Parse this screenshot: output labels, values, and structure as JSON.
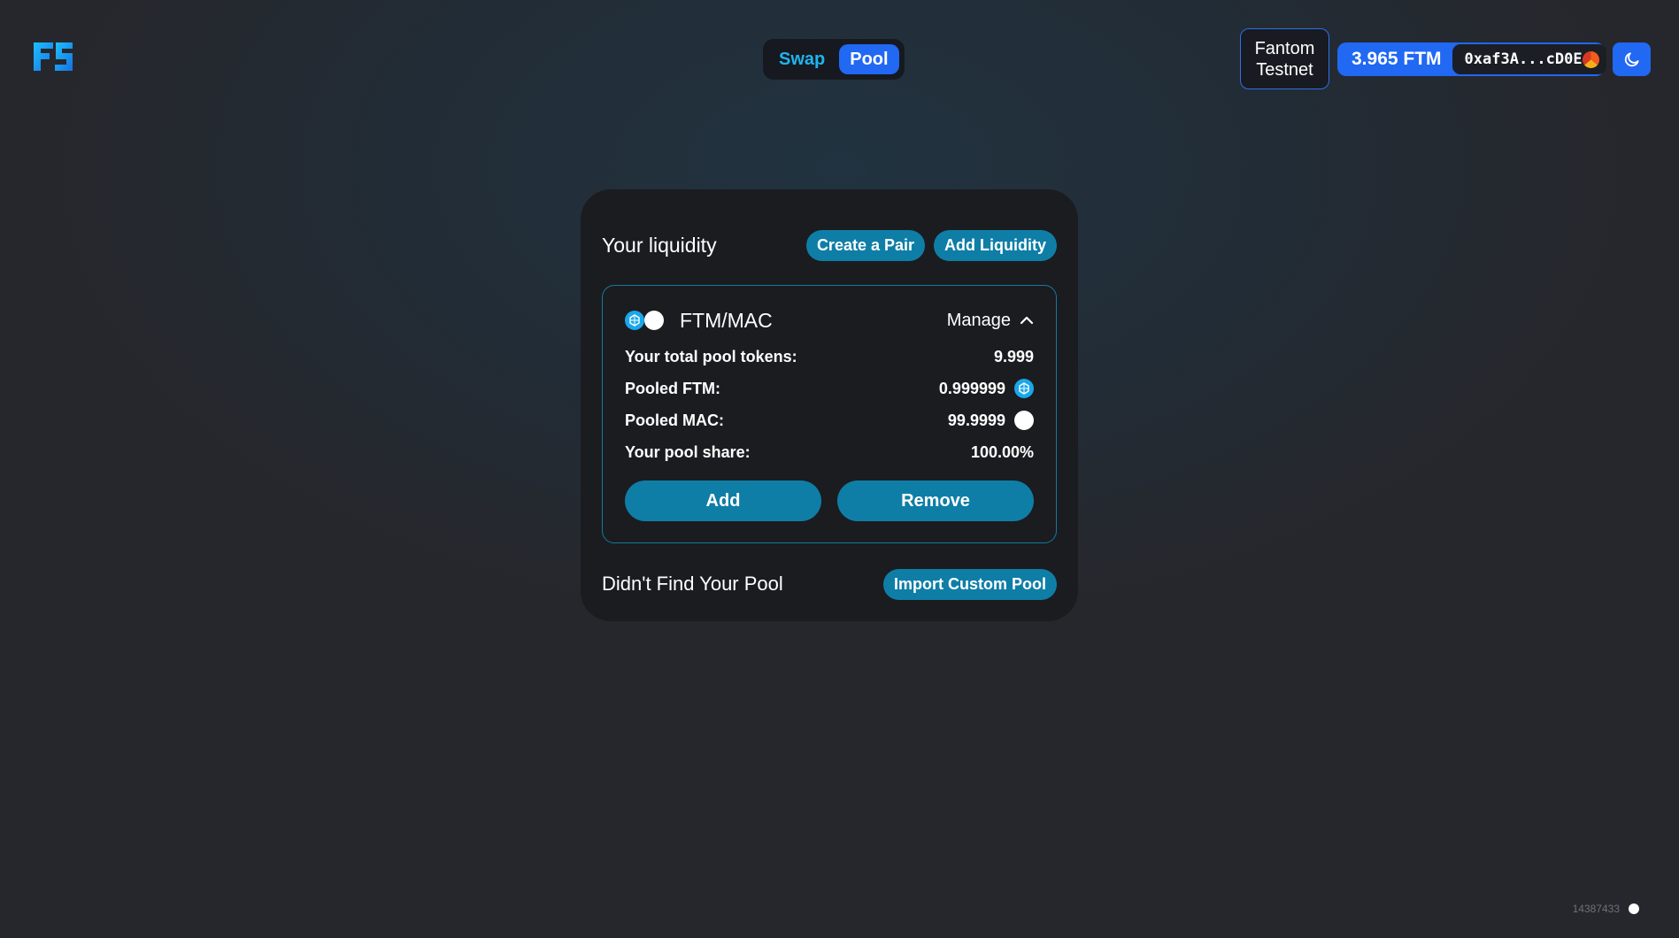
{
  "header": {
    "logo": "fs-logo",
    "nav": [
      {
        "label": "Swap",
        "active": false
      },
      {
        "label": "Pool",
        "active": true
      }
    ],
    "network": {
      "line1": "Fantom",
      "line2": "Testnet"
    },
    "wallet": {
      "balance": "3.965 FTM",
      "address": "0xaf3A...cD0E"
    },
    "theme_icon": "moon-icon"
  },
  "liquidity": {
    "title": "Your liquidity",
    "create_pair_label": "Create a Pair",
    "add_liquidity_label": "Add Liquidity",
    "pool": {
      "pair": "FTM/MAC",
      "manage_label": "Manage",
      "rows": [
        {
          "label": "Your total pool tokens:",
          "value": "9.999"
        },
        {
          "label": "Pooled FTM:",
          "value": "0.999999",
          "icon": "ftm-token-icon"
        },
        {
          "label": "Pooled MAC:",
          "value": "99.9999",
          "icon": "mac-token-icon"
        },
        {
          "label": "Your pool share:",
          "value": "100.00%"
        }
      ],
      "add_label": "Add",
      "remove_label": "Remove"
    },
    "footer_text": "Didn't Find Your Pool",
    "import_label": "Import Custom Pool"
  },
  "status": {
    "block_number": "14387433"
  },
  "colors": {
    "accent_blue": "#2168f3",
    "accent_teal": "#0f7ea6",
    "ftm_blue": "#1aa7ec",
    "card_bg": "#1b1c20"
  }
}
